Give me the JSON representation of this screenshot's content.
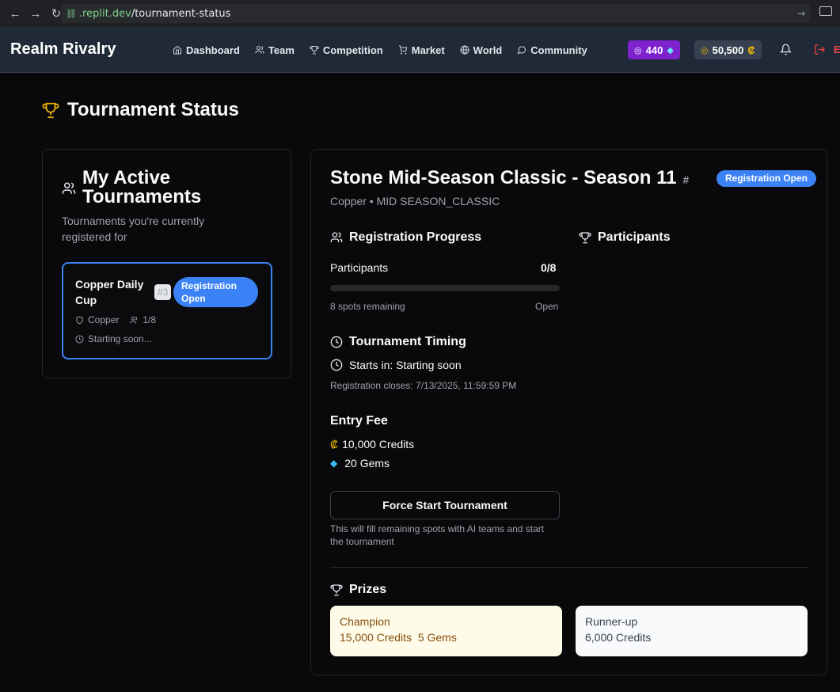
{
  "browser": {
    "url_host": ".replit.dev",
    "url_path": "/tournament-status"
  },
  "header": {
    "brand": "Realm Rivalry",
    "nav": [
      {
        "label": "Dashboard",
        "icon": "home-icon"
      },
      {
        "label": "Team",
        "icon": "users-icon"
      },
      {
        "label": "Competition",
        "icon": "trophy-icon"
      },
      {
        "label": "Market",
        "icon": "cart-icon"
      },
      {
        "label": "World",
        "icon": "globe-icon"
      },
      {
        "label": "Community",
        "icon": "chat-icon"
      }
    ],
    "gems": "440",
    "credits": "50,500",
    "logout_cut": "E"
  },
  "page": {
    "title": "Tournament Status"
  },
  "active": {
    "title": "My Active Tournaments",
    "subtitle": "Tournaments you're currently registered for",
    "card": {
      "name": "Copper Daily Cup",
      "number": "#3",
      "status": "Registration Open",
      "division": "Copper",
      "participants": "1/8",
      "time": "Starting soon..."
    }
  },
  "detail": {
    "title": "Stone Mid-Season Classic - Season 11",
    "hash": "#",
    "badge": "Registration Open",
    "subtitle": "Copper • MID SEASON_CLASSIC",
    "progress_heading": "Registration Progress",
    "participants_label": "Participants",
    "participants_value": "0/8",
    "progress_fraction": 0,
    "spots_remaining": "8 spots remaining",
    "open_label": "Open",
    "participants_heading": "Participants",
    "timing_heading": "Tournament Timing",
    "starts_in": "Starts in: Starting soon",
    "reg_closes": "Registration closes: 7/13/2025, 11:59:59 PM",
    "entry_heading": "Entry Fee",
    "fee_credits": "10,000 Credits",
    "fee_gems": "20 Gems",
    "force_button": "Force Start Tournament",
    "force_hint": "This will fill remaining spots with AI teams and start the tournament",
    "prizes_heading": "Prizes",
    "prizes": [
      {
        "place": "Champion",
        "value": "15,000 Credits  5 Gems"
      },
      {
        "place": "Runner-up",
        "value": "6,000 Credits"
      }
    ]
  },
  "colors": {
    "accent": "#3b82f6",
    "gem_pill": "#7e22ce",
    "trophy": "#eab308",
    "logout": "#ef4444"
  }
}
